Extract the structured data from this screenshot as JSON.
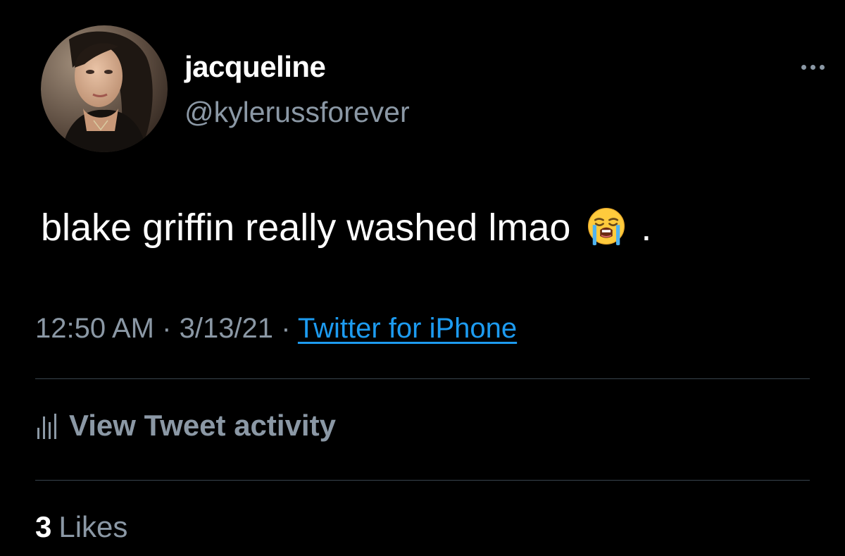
{
  "user": {
    "display_name": "jacqueline",
    "handle": "@kylerussforever"
  },
  "tweet": {
    "text_before_emoji": "blake griffin really washed lmao",
    "emoji": "loudly-crying-face",
    "text_after_emoji": "."
  },
  "meta": {
    "time": "12:50 AM",
    "date": "3/13/21",
    "separator": "·",
    "source": "Twitter for iPhone"
  },
  "activity": {
    "label": "View Tweet activity",
    "icon": "analytics-bars-icon"
  },
  "likes": {
    "count": "3",
    "label": "Likes"
  },
  "colors": {
    "background": "#000000",
    "primary_text": "#ffffff",
    "secondary_text": "#8b98a5",
    "link": "#1d9bf0",
    "divider": "#38444d"
  }
}
